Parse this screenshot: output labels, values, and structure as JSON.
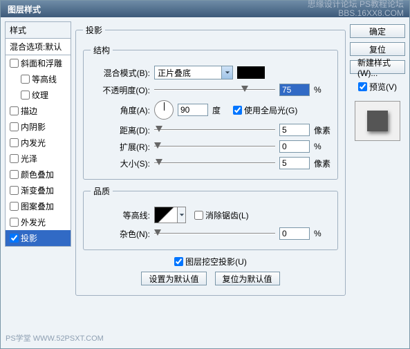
{
  "window": {
    "title": "图层样式"
  },
  "watermark": {
    "l1": "思缘设计论坛    PS教程论坛",
    "l2": "BBS.16XX8.COM"
  },
  "styles": {
    "header": "样式",
    "sub": "混合选项:默认",
    "items": [
      {
        "label": "斜面和浮雕",
        "checked": false,
        "indent": 0
      },
      {
        "label": "等高线",
        "checked": false,
        "indent": 1
      },
      {
        "label": "纹理",
        "checked": false,
        "indent": 1
      },
      {
        "label": "描边",
        "checked": false,
        "indent": 0
      },
      {
        "label": "内阴影",
        "checked": false,
        "indent": 0
      },
      {
        "label": "内发光",
        "checked": false,
        "indent": 0
      },
      {
        "label": "光泽",
        "checked": false,
        "indent": 0
      },
      {
        "label": "颜色叠加",
        "checked": false,
        "indent": 0
      },
      {
        "label": "渐变叠加",
        "checked": false,
        "indent": 0
      },
      {
        "label": "图案叠加",
        "checked": false,
        "indent": 0
      },
      {
        "label": "外发光",
        "checked": false,
        "indent": 0
      },
      {
        "label": "投影",
        "checked": true,
        "indent": 0,
        "selected": true
      }
    ]
  },
  "panel": {
    "legend": "投影",
    "structure": {
      "legend": "结构",
      "blend_mode_label": "混合模式(B):",
      "blend_mode_value": "正片叠底",
      "color": "#000000",
      "opacity_label": "不透明度(O):",
      "opacity_value": "75",
      "opacity_unit": "%",
      "angle_label": "角度(A):",
      "angle_value": "90",
      "angle_unit": "度",
      "global_light_label": "使用全局光(G)",
      "global_light_checked": true,
      "distance_label": "距离(D):",
      "distance_value": "5",
      "distance_unit": "像素",
      "spread_label": "扩展(R):",
      "spread_value": "0",
      "spread_unit": "%",
      "size_label": "大小(S):",
      "size_value": "5",
      "size_unit": "像素"
    },
    "quality": {
      "legend": "品质",
      "contour_label": "等高线:",
      "antialias_label": "消除锯齿(L)",
      "antialias_checked": false,
      "noise_label": "杂色(N):",
      "noise_value": "0",
      "noise_unit": "%"
    },
    "knockout_label": "图层挖空投影(U)",
    "knockout_checked": true,
    "reset_default": "设置为默认值",
    "restore_default": "复位为默认值"
  },
  "right": {
    "ok": "确定",
    "cancel": "复位",
    "new_style": "新建样式(W)...",
    "preview_label": "预览(V)",
    "preview_checked": true
  },
  "footer": "PS学堂  WWW.52PSXT.COM"
}
